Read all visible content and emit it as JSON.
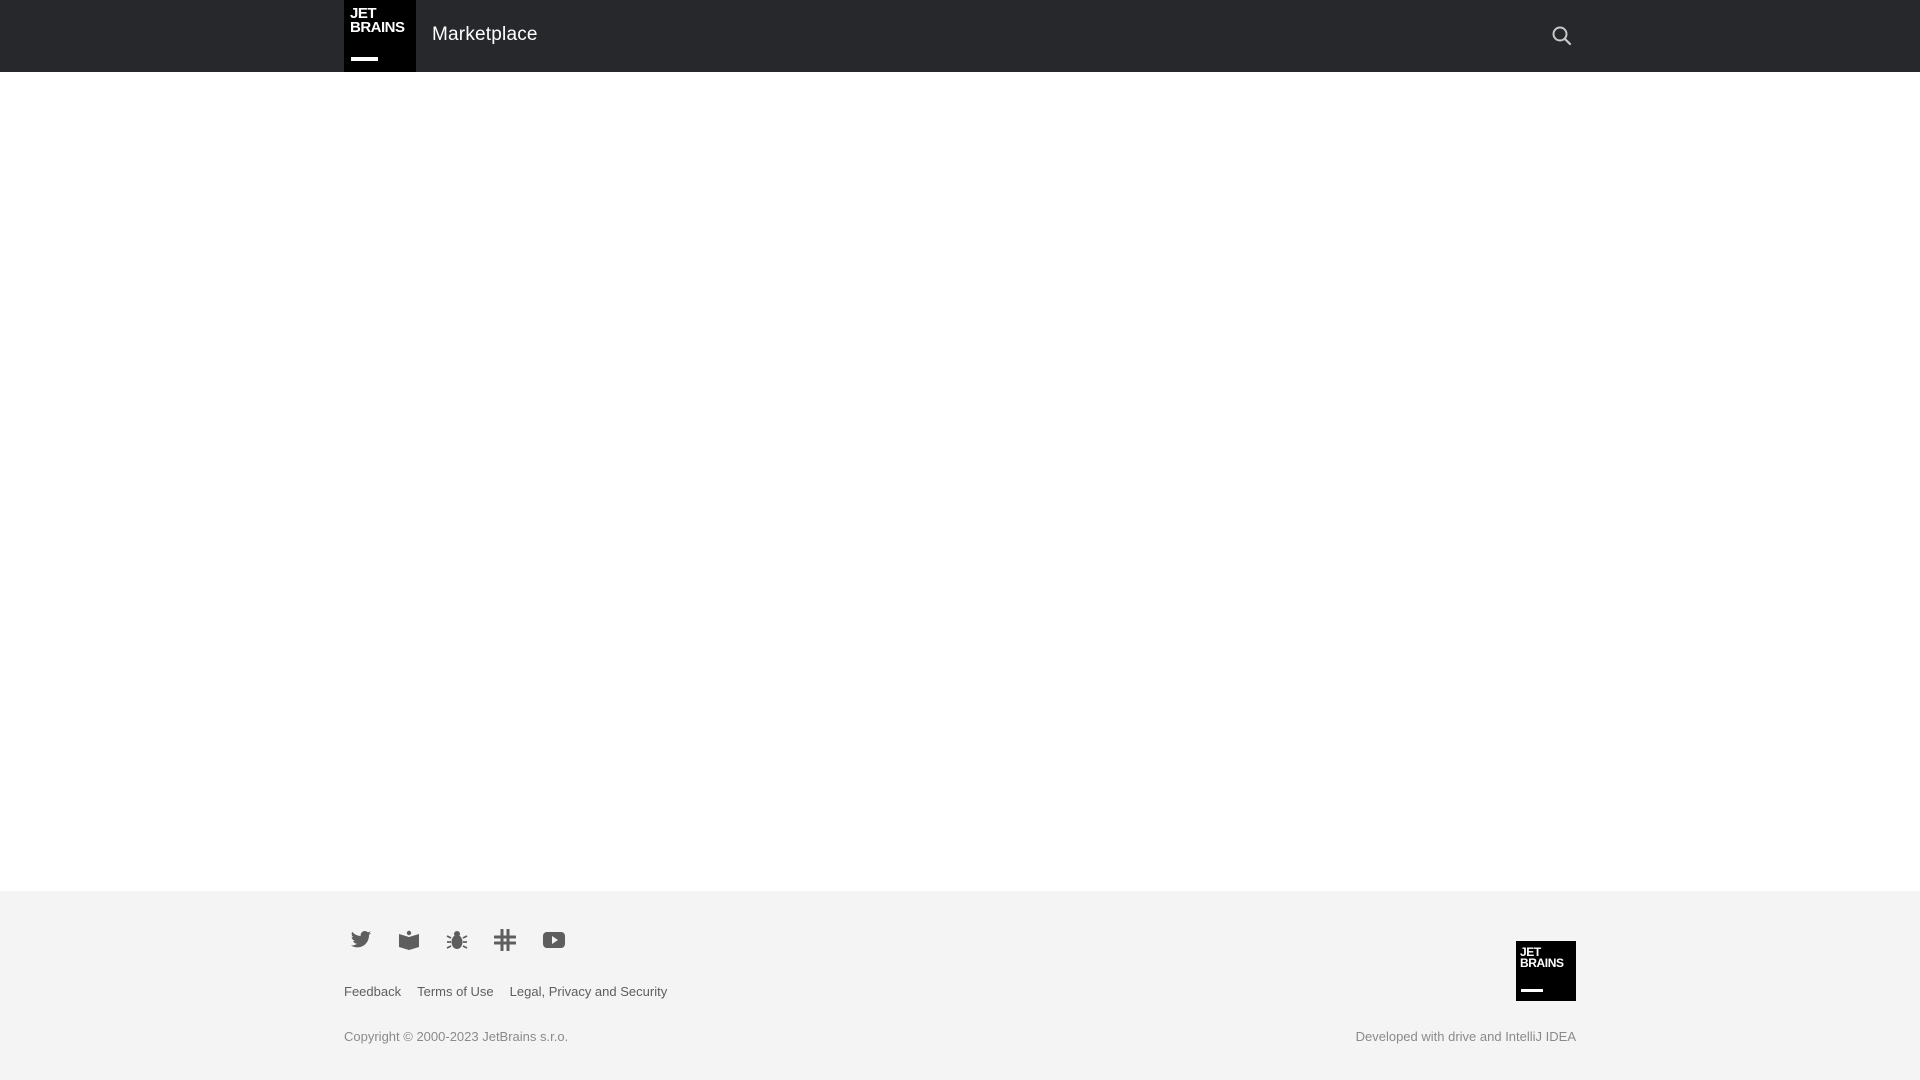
{
  "header": {
    "logo_text": "JET\nBRAINS",
    "title": "Marketplace",
    "search_icon": "search-icon"
  },
  "footer": {
    "social_icons": [
      "twitter-icon",
      "blog-icon",
      "bug-icon",
      "slack-icon",
      "youtube-icon"
    ],
    "links": [
      "Feedback",
      "Terms of Use",
      "Legal, Privacy and Security"
    ],
    "copyright": "Copyright © 2000-2023 JetBrains s.r.o.",
    "logo_text": "JET\nBRAINS",
    "developed": "Developed with drive and IntelliJ IDEA"
  },
  "colors": {
    "header_bg": "#27282c",
    "footer_bg": "#f4f4f4",
    "icon": "#5e5e5e"
  }
}
